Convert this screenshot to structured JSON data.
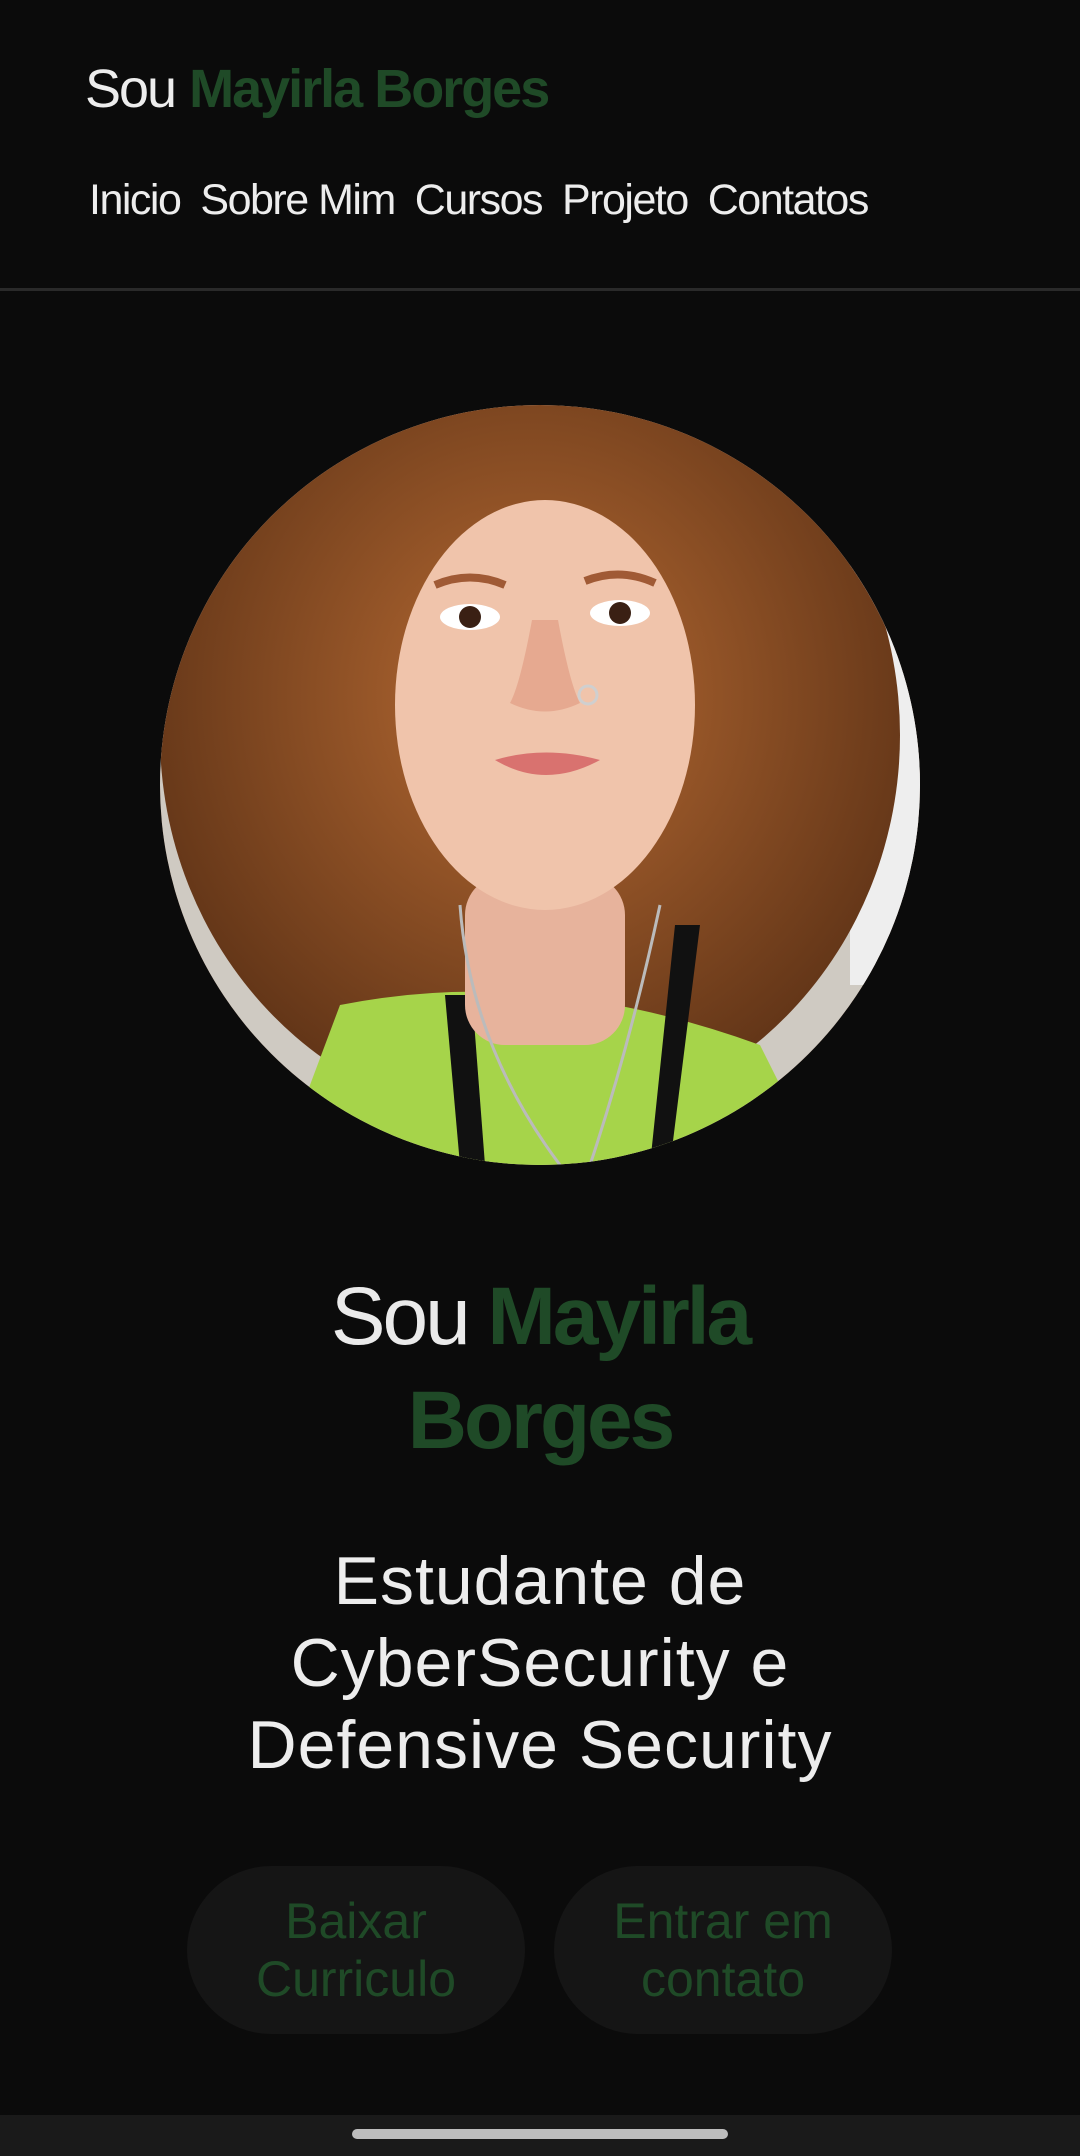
{
  "header": {
    "logo_prefix": "Sou",
    "logo_name": "Mayirla Borges",
    "nav": [
      "Inicio",
      "Sobre Mim",
      "Cursos",
      "Projeto",
      "Contatos"
    ]
  },
  "hero": {
    "heading_prefix": "Sou",
    "heading_name_line1": "Mayirla",
    "heading_name_line2": "Borges",
    "subtitle_lines": [
      "Estudante de",
      "CyberSecurity e",
      "Defensive Security"
    ]
  },
  "buttons": {
    "download_cv": [
      "Baixar",
      "Curriculo"
    ],
    "contact": [
      "Entrar em",
      "contato"
    ]
  },
  "colors": {
    "accent": "#1f4a27",
    "background": "#0b0b0b",
    "button_bg": "#151515"
  }
}
